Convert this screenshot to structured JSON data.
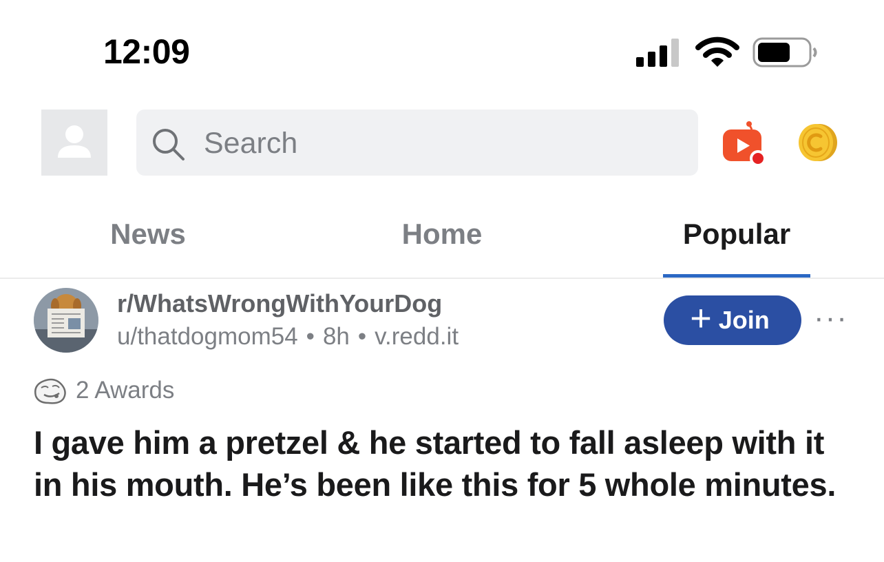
{
  "status_bar": {
    "time": "12:09"
  },
  "search": {
    "placeholder": "Search"
  },
  "tabs": [
    {
      "label": "News",
      "active": false
    },
    {
      "label": "Home",
      "active": false
    },
    {
      "label": "Popular",
      "active": true
    }
  ],
  "post": {
    "subreddit": "r/WhatsWrongWithYourDog",
    "author": "u/thatdogmom54",
    "age": "8h",
    "domain": "v.redd.it",
    "separator": "•",
    "join_label": "Join",
    "join_plus": "+",
    "more_label": "···",
    "awards": "2 Awards",
    "title": "I gave him a pretzel & he started to fall asleep with it in his mouth. He’s been like this for 5 whole minutes."
  },
  "colors": {
    "accent_blue": "#2b68c4",
    "join_button": "#2b4fa3",
    "live_icon": "#f0512b",
    "coin": "#f2c12e"
  },
  "icons": [
    "signal-icon",
    "wifi-icon",
    "battery-icon",
    "user-avatar-icon",
    "search-icon",
    "reddit-live-icon",
    "coins-icon",
    "award-icon",
    "more-icon"
  ]
}
